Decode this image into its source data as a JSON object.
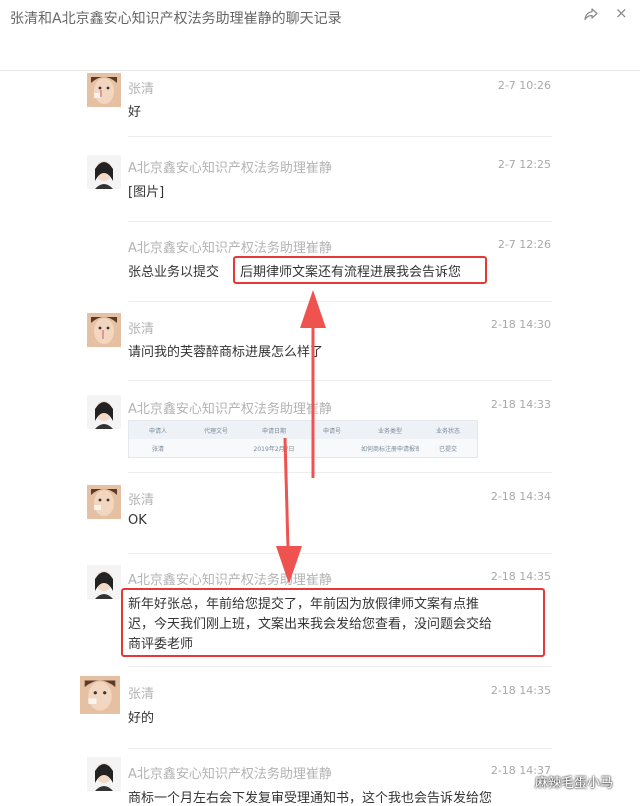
{
  "window": {
    "title": "张清和A北京鑫安心知识产权法务助理崔静的聊天记录"
  },
  "icons": {
    "share": "share-icon",
    "close": "close-icon",
    "close_glyph": "×"
  },
  "messages": [
    {
      "sender": "张清",
      "time": "2-7 10:26",
      "text": "好",
      "avatar": "zhang-avatar"
    },
    {
      "sender": "A北京鑫安心知识产权法务助理崔静",
      "time": "2-7 12:25",
      "text": "[图片]",
      "avatar": "cui-avatar"
    },
    {
      "sender": "A北京鑫安心知识产权法务助理崔静",
      "time": "2-7 12:26",
      "text_prefix": "张总业务以提交",
      "text_highlight": "后期律师文案还有流程进展我会告诉您"
    },
    {
      "sender": "张清",
      "time": "2-18 14:30",
      "text": "请问我的芙蓉醉商标进展怎么样了",
      "avatar": "zhang-avatar"
    },
    {
      "sender": "A北京鑫安心知识产权法务助理崔静",
      "time": "2-18 14:33",
      "avatar": "cui-avatar",
      "table": {
        "headers": [
          "申请人",
          "代理文号",
          "申请日期",
          "申请号",
          "业务类型",
          "业务状态"
        ],
        "row": [
          "张清",
          "",
          "2019年2月7日",
          "",
          "如何商标注册申请报审中通",
          "已提交"
        ]
      }
    },
    {
      "sender": "张清",
      "time": "2-18 14:34",
      "text": "OK",
      "avatar": "zhang-avatar"
    },
    {
      "sender": "A北京鑫安心知识产权法务助理崔静",
      "time": "2-18 14:35",
      "avatar": "cui-avatar",
      "lines": [
        "新年好张总，年前给您提交了，年前因为放假律师文案有点推",
        "迟，今天我们刚上班，文案出来我会发给您查看，没问题会交给",
        "商评委老师"
      ]
    },
    {
      "sender": "张清",
      "time": "2-18 14:35",
      "text": "好的",
      "avatar": "zhang-avatar"
    },
    {
      "sender": "A北京鑫安心知识产权法务助理崔静",
      "time": "2-18 14:37",
      "text": "商标一个月左右会下发复审受理通知书，这个我也会告诉发给您",
      "avatar": "cui-avatar"
    }
  ],
  "watermark": "麻辣毛蛋小马",
  "colors": {
    "highlight": "#e53935",
    "arrow": "#ef5350"
  }
}
